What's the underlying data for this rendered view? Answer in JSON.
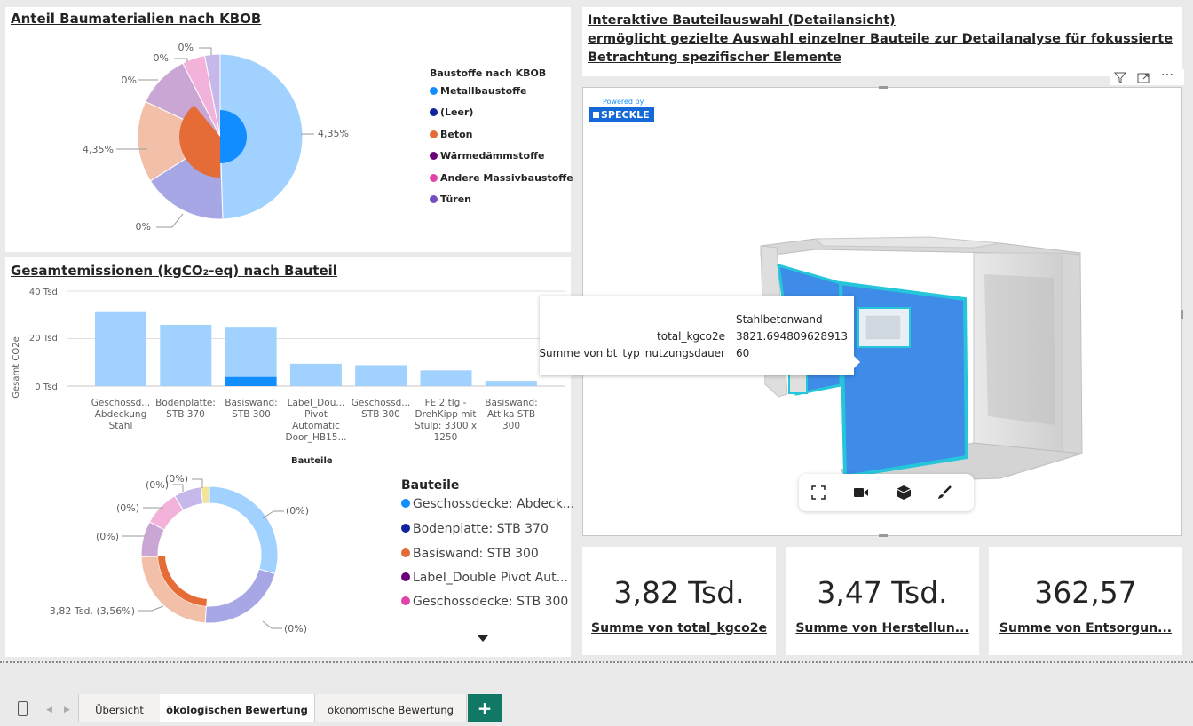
{
  "pie_panel": {
    "title": "Anteil Baumaterialien nach KBOB",
    "legend_title": "Baustoffe nach KBOB",
    "legend": [
      {
        "label": "Metallbaustoffe",
        "color": "#118DFF"
      },
      {
        "label": "(Leer)",
        "color": "#12239E"
      },
      {
        "label": "Beton",
        "color": "#E66C37"
      },
      {
        "label": "Wärmedämmstoffe",
        "color": "#6B007B"
      },
      {
        "label": "Andere Massivbaustoffe",
        "color": "#E044A7"
      },
      {
        "label": "Türen",
        "color": "#744EC2"
      }
    ],
    "slice_labels": [
      "4,35%",
      "0%",
      "4,35%",
      "0%",
      "0%",
      "0%"
    ]
  },
  "bar_panel": {
    "title": "Gesamtemissionen (kgCO₂-eq) nach Bauteil",
    "y_axis_label": "Gesamt CO2e",
    "x_axis_label": "Bauteile",
    "y_ticks": [
      "40 Tsd.",
      "20 Tsd.",
      "0 Tsd."
    ],
    "categories": [
      "Geschossd... Abdeckung Stahl",
      "Bodenplatte: STB 370",
      "Basiswand: STB 300",
      "Label_Dou... Pivot Automatic Door_HB15...",
      "Geschossd... STB 300",
      "FE 2 tlg - DrehKipp mit Stulp: 3300 x 1250",
      "Basiswand: Attika STB 300"
    ]
  },
  "chart_data": {
    "type": "bar",
    "categories": [
      "Geschossd... Abdeckung Stahl",
      "Bodenplatte: STB 370",
      "Basiswand: STB 300",
      "Label_Dou... Pivot Automatic Door_HB15...",
      "Geschossd... STB 300",
      "FE 2 tlg - DrehKipp mit Stulp: 3300 x 1250",
      "Basiswand: Attika STB 300"
    ],
    "values": [
      31500,
      25800,
      24600,
      9400,
      8800,
      6600,
      2200
    ],
    "highlight": {
      "category": "Basiswand: STB 300",
      "value": 3821.694809628913,
      "color": "#118DFF"
    },
    "ylabel": "Gesamt CO2e",
    "xlabel": "Bauteile",
    "ylim": [
      0,
      40000
    ],
    "grid": true,
    "bar_color": "#A0D1FF"
  },
  "donut_panel": {
    "legend_title": "Bauteile",
    "legend": [
      {
        "label": "Geschossdecke: Abdeck...",
        "color": "#118DFF"
      },
      {
        "label": "Bodenplatte: STB 370",
        "color": "#12239E"
      },
      {
        "label": "Basiswand: STB 300",
        "color": "#E66C37"
      },
      {
        "label": "Label_Double Pivot Aut...",
        "color": "#6B007B"
      },
      {
        "label": "Geschossdecke: STB 300",
        "color": "#E044A7"
      }
    ],
    "slice_labels": [
      "(0%)",
      "(0%)",
      "3,82 Tsd. (3,56%)",
      "(0%)",
      "(0%)",
      "(0%)",
      "(0%)"
    ]
  },
  "viewer_panel": {
    "title_line1": "Interaktive Bauteilauswahl (Detailansicht)",
    "title_line2": "ermöglicht gezielte Auswahl einzelner Bauteile zur Detailanalyse für fokussierte",
    "title_line3": "Betrachtung spezifischer Elemente",
    "powered_by": "Powered by",
    "brand": "SPECKLE"
  },
  "tooltip": {
    "header": "Stahlbetonwand",
    "rows": [
      {
        "key": "total_kgco2e",
        "value": "3821.694809628913"
      },
      {
        "key": "Summe von bt_typ_nutzungsdauer",
        "value": "60"
      }
    ]
  },
  "kpis": [
    {
      "value": "3,82 Tsd.",
      "label": "Summe von total_kgco2e"
    },
    {
      "value": "3,47 Tsd.",
      "label": "Summe von Herstellun..."
    },
    {
      "value": "362,57",
      "label": "Summe von Entsorgun..."
    }
  ],
  "tabs": [
    {
      "label": "Übersicht",
      "active": false
    },
    {
      "label": "ökologischen Bewertung",
      "active": true
    },
    {
      "label": "ökonomische Bewertung",
      "active": false
    }
  ],
  "add_tab_label": "+"
}
